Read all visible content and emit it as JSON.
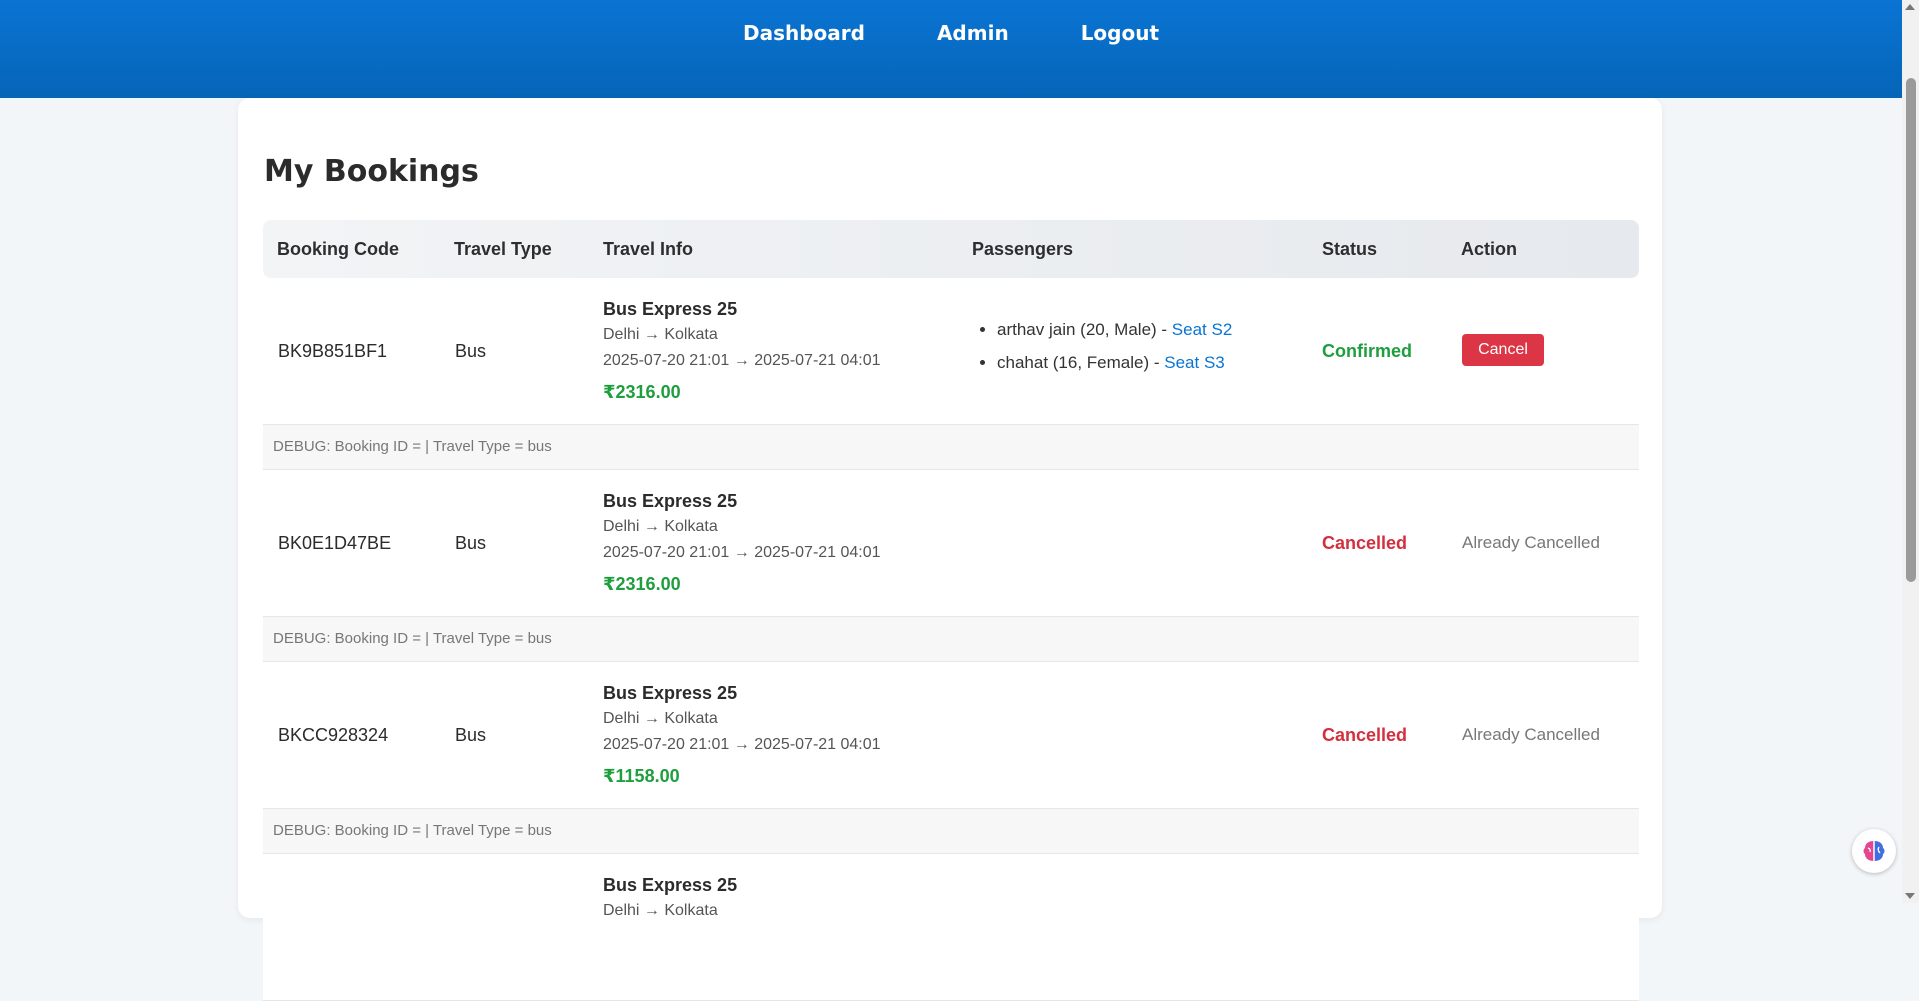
{
  "nav": {
    "items": [
      {
        "label": "Dashboard"
      },
      {
        "label": "Admin"
      },
      {
        "label": "Logout"
      }
    ]
  },
  "page": {
    "title": "My Bookings"
  },
  "table": {
    "headers": [
      "Booking Code",
      "Travel Type",
      "Travel Info",
      "Passengers",
      "Status",
      "Action"
    ],
    "rows": [
      {
        "code": "BK9B851BF1",
        "type": "Bus",
        "name": "Bus Express 25",
        "route": "Delhi → Kolkata",
        "times": "2025-07-20 21:01 → 2025-07-21 04:01",
        "price": "₹2316.00",
        "passengers": [
          {
            "text": "arthav jain (20, Male) - ",
            "seat": "Seat S2"
          },
          {
            "text": "chahat (16, Female) - ",
            "seat": "Seat S3"
          }
        ],
        "status": "Confirmed",
        "action": "Cancel",
        "debug": "DEBUG: Booking ID = | Travel Type = bus"
      },
      {
        "code": "BK0E1D47BE",
        "type": "Bus",
        "name": "Bus Express 25",
        "route": "Delhi → Kolkata",
        "times": "2025-07-20 21:01 → 2025-07-21 04:01",
        "price": "₹2316.00",
        "status": "Cancelled",
        "action": "Already Cancelled",
        "debug": "DEBUG: Booking ID = | Travel Type = bus"
      },
      {
        "code": "BKCC928324",
        "type": "Bus",
        "name": "Bus Express 25",
        "route": "Delhi → Kolkata",
        "times": "2025-07-20 21:01 → 2025-07-21 04:01",
        "price": "₹1158.00",
        "status": "Cancelled",
        "action": "Already Cancelled",
        "debug": "DEBUG: Booking ID = | Travel Type = bus"
      },
      {
        "name": "Bus Express 25",
        "route": "Delhi → Kolkata"
      }
    ]
  },
  "colors": {
    "header_blue": "#0a74d3",
    "confirmed": "#1e9e3e",
    "cancelled": "#d32f3e",
    "cancel_button": "#dc3545"
  },
  "icons": {
    "helper": "brain-icon"
  }
}
